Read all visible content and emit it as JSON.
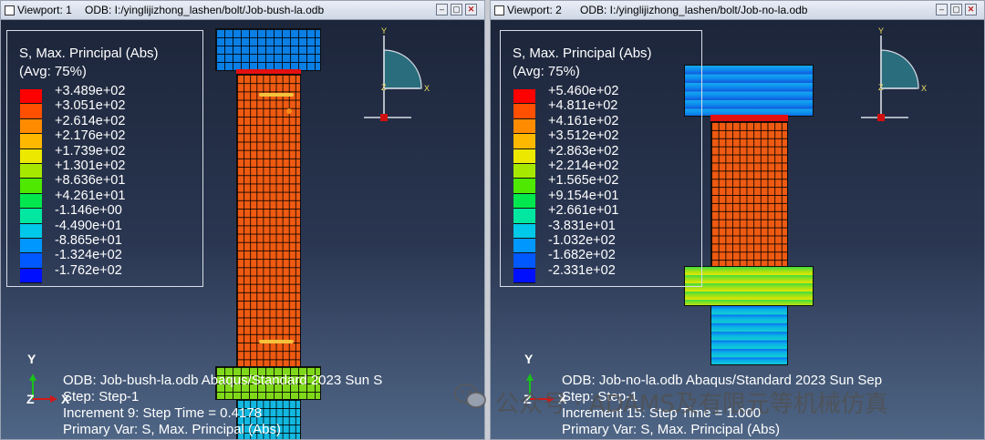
{
  "viewports": [
    {
      "title": "Viewport: 1",
      "odb_path": "ODB: I:/yinglijizhong_lashen/bolt/Job-bush-la.odb",
      "legend": {
        "title": "S, Max. Principal (Abs)",
        "avg": "(Avg: 75%)",
        "values": [
          "+3.489e+02",
          "+3.051e+02",
          "+2.614e+02",
          "+2.176e+02",
          "+1.739e+02",
          "+1.301e+02",
          "+8.636e+01",
          "+4.261e+01",
          "-1.146e+00",
          "-4.490e+01",
          "-8.865e+01",
          "-1.324e+02",
          "-1.762e+02"
        ]
      },
      "info": {
        "odb_line": "ODB: Job-bush-la.odb    Abaqus/Standard 2023    Sun S",
        "step_line": "Step: Step-1",
        "increment_line": "Increment     9: Step Time =    0.4178",
        "primary_line": "Primary Var: S, Max. Principal (Abs)"
      }
    },
    {
      "title": "Viewport: 2",
      "odb_path": "ODB: I:/yinglijizhong_lashen/bolt/Job-no-la.odb",
      "legend": {
        "title": "S, Max. Principal (Abs)",
        "avg": "(Avg: 75%)",
        "values": [
          "+5.460e+02",
          "+4.811e+02",
          "+4.161e+02",
          "+3.512e+02",
          "+2.863e+02",
          "+2.214e+02",
          "+1.565e+02",
          "+9.154e+01",
          "+2.661e+01",
          "-3.831e+01",
          "-1.032e+02",
          "-1.682e+02",
          "-2.331e+02"
        ]
      },
      "info": {
        "odb_line": "ODB: Job-no-la.odb    Abaqus/Standard 2023    Sun Sep",
        "step_line": "Step: Step-1",
        "increment_line": "Increment    15: Step Time =    1.000",
        "primary_line": "Primary Var: S, Max. Principal (Abs)"
      }
    }
  ],
  "axes": {
    "x": "X",
    "y": "Y",
    "z": "Z"
  },
  "window_buttons": {
    "minimize": "–",
    "restore": "▢",
    "close": "✕"
  },
  "colors": {
    "contour": [
      "#ff0000",
      "#ff4f00",
      "#ff8c00",
      "#ffb800",
      "#ece800",
      "#a6e800",
      "#4ee800",
      "#00e84e",
      "#00e8a0",
      "#00c8e8",
      "#0098ff",
      "#0058ff",
      "#0010ff"
    ]
  },
  "watermark": "公众号 · ADAMS及有限元等机械仿真"
}
